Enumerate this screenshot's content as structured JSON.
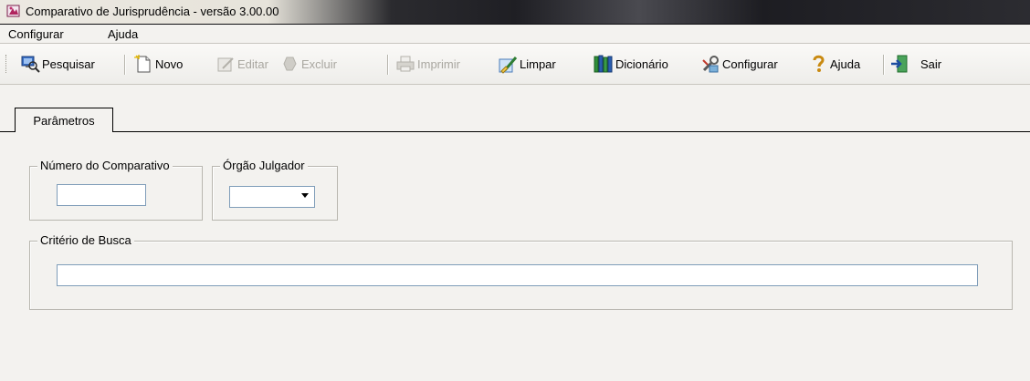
{
  "window": {
    "title": "Comparativo de Jurisprudência - versão 3.00.00"
  },
  "menu": {
    "items": [
      "Configurar",
      "Ajuda"
    ]
  },
  "toolbar": {
    "buttons": [
      {
        "label": "Pesquisar",
        "icon": "search-icon",
        "enabled": true
      },
      {
        "label": "Novo",
        "icon": "new-document-icon",
        "enabled": true
      },
      {
        "label": "Editar",
        "icon": "edit-icon",
        "enabled": false
      },
      {
        "label": "Excluir",
        "icon": "delete-icon",
        "enabled": false
      },
      {
        "label": "Imprimir",
        "icon": "printer-icon",
        "enabled": false
      },
      {
        "label": "Limpar",
        "icon": "clear-icon",
        "enabled": true
      },
      {
        "label": "Dicionário",
        "icon": "books-icon",
        "enabled": true
      },
      {
        "label": "Configurar",
        "icon": "settings-icon",
        "enabled": true
      },
      {
        "label": "Ajuda",
        "icon": "help-icon",
        "enabled": true
      },
      {
        "label": "Sair",
        "icon": "exit-icon",
        "enabled": true
      }
    ]
  },
  "tabs": [
    {
      "label": "Parâmetros",
      "active": true
    }
  ],
  "form": {
    "numero_comparativo": {
      "label": "Número do Comparativo",
      "value": ""
    },
    "orgao_julgador": {
      "label": "Órgão Julgador",
      "value": ""
    },
    "criterio_busca": {
      "label": "Critério de Busca",
      "value": ""
    }
  },
  "colors": {
    "window_bg": "#f3f2ef",
    "input_border": "#7f9db9",
    "disabled_text": "#a9a7a0"
  }
}
